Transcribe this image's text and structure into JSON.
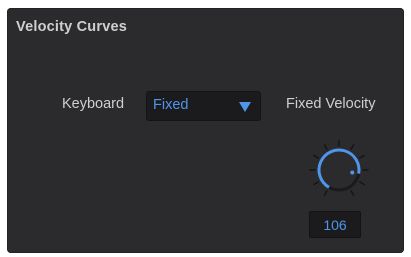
{
  "panel": {
    "title": "Velocity Curves"
  },
  "keyboard": {
    "label": "Keyboard",
    "selected": "Fixed",
    "arrow_icon": "triangle-down-icon"
  },
  "fixed_velocity": {
    "label": "Fixed Velocity",
    "value": "106",
    "knob_level": 0.835,
    "knob_icon": "rotary-knob"
  },
  "colors": {
    "panel_bg": "#2b2b2d",
    "text": "#cfcfd2",
    "accent": "#4f95e9",
    "field_bg": "#1b1b1d"
  }
}
